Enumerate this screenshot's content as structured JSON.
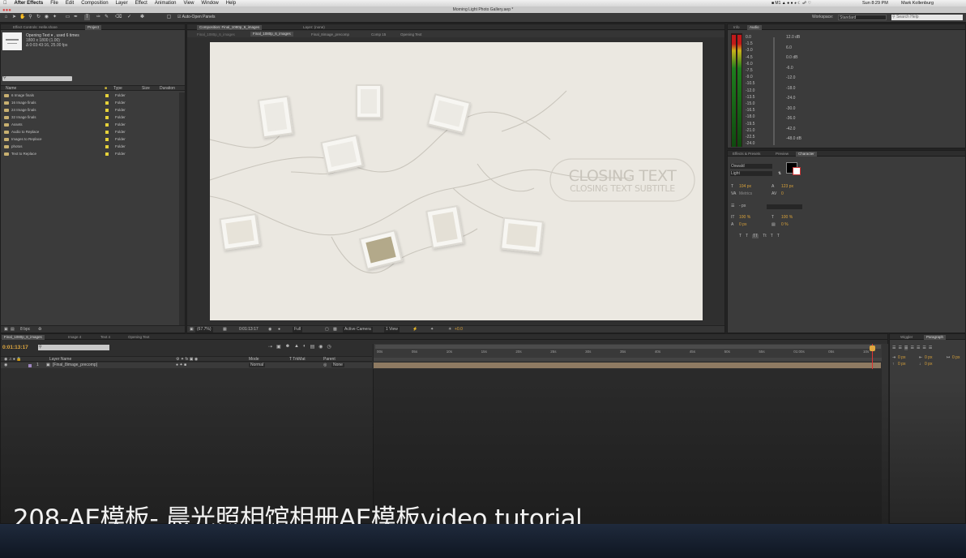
{
  "menubar": {
    "app": "After Effects",
    "items": [
      "File",
      "Edit",
      "Composition",
      "Layer",
      "Effect",
      "Animation",
      "View",
      "Window",
      "Help"
    ],
    "status_time": "Sun 8:29 PM",
    "user": "Mark Kollenburg"
  },
  "window_title": "Morning Light Photo Gallery.aep *",
  "toolbar": {
    "auto_open": "Auto-Open Panels",
    "workspace_label": "Workspace:",
    "workspace_value": "Standard",
    "search_placeholder": "Search Help"
  },
  "project_panel": {
    "tabs": [
      "Effect Controls: Helle.share",
      "Project"
    ],
    "selected_name": "Opening Text ▾ , used 6 times",
    "selected_dims": "1800 x 1800 (1.00)",
    "selected_duration": "Δ 0:03:43:16, 25.00 fps",
    "columns": [
      "Name",
      "Type",
      "Size",
      "Duration"
    ],
    "items": [
      {
        "name": "6 Image finals",
        "type": "Folder"
      },
      {
        "name": "16 Image finals",
        "type": "Folder"
      },
      {
        "name": "24 Image finals",
        "type": "Folder"
      },
      {
        "name": "32 Image finals",
        "type": "Folder"
      },
      {
        "name": "Assets",
        "type": "Folder"
      },
      {
        "name": "Audio to Replace",
        "type": "Folder"
      },
      {
        "name": "Images to Replace",
        "type": "Folder"
      },
      {
        "name": "photos",
        "type": "Folder"
      },
      {
        "name": "Text to Replace",
        "type": "Folder"
      }
    ],
    "bpc": "8 bpc"
  },
  "composition": {
    "panel_tabs": [
      "Composition: Final_1080p_6_images",
      "Layer: (none)"
    ],
    "breadcrumbs": [
      "Final_1080p_6_images",
      "Final_1080p_6_images",
      "Final_8image_precomp",
      "Comp 15",
      "Opening Text"
    ],
    "closing_text": "CLOSING TEXT",
    "closing_subtitle": "CLOSING TEXT SUBTITLE",
    "zoom": "(67.7%)",
    "timecode": "0:01:13:17",
    "resolution": "Full",
    "camera": "Active Camera",
    "views": "1 View",
    "exposure": "+0.0"
  },
  "info_panel": {
    "tabs": [
      "Info",
      "Audio"
    ],
    "left_scale": [
      "0.0",
      "-1.5",
      "-3.0",
      "-4.5",
      "-6.0",
      "-7.5",
      "-9.0",
      "-10.5",
      "-12.0",
      "-13.5",
      "-15.0",
      "-16.5",
      "-18.0",
      "-19.5",
      "-21.0",
      "-22.5",
      "-24.0"
    ],
    "right_scale": [
      "12.0 dB",
      "6.0",
      "0.0 dB",
      "-6.0",
      "-12.0",
      "-18.0",
      "-24.0",
      "-30.0",
      "-36.0",
      "-42.0",
      "-48.0 dB"
    ]
  },
  "character_panel": {
    "tabs": [
      "Effects & Presets",
      "Preview",
      "Character"
    ],
    "font": "Oswald",
    "style": "Light",
    "size": "104 px",
    "leading": "123 px",
    "kerning": "Metrics",
    "tracking": "0",
    "stroke": "- px",
    "vscale": "100 %",
    "hscale": "100 %",
    "baseline": "0 px",
    "tsume": "0 %",
    "format_buttons": [
      "T",
      "T",
      "TT",
      "Tt",
      "T",
      "T"
    ]
  },
  "timeline": {
    "tabs": [
      "Final_1080p_6_images",
      "Image 4",
      "Text 4",
      "Opening Text"
    ],
    "timecode": "0:01:13:17",
    "columns": [
      "Layer Name",
      "Mode",
      "T TrkMat",
      "Parent"
    ],
    "layer": {
      "number": "1",
      "name": "[Final_8image_precomp]",
      "mode": "Normal",
      "parent": "None"
    },
    "ruler": [
      "00s",
      "05s",
      "10s",
      "15s",
      "20s",
      "25s",
      "30s",
      "35s",
      "40s",
      "45s",
      "50s",
      "55s",
      "01:00s",
      "05s",
      "10s"
    ]
  },
  "paragraph_panel": {
    "tabs": [
      "Wiggler",
      "Paragraph"
    ],
    "values": [
      "0 px",
      "0 px",
      "0 px",
      "0 px",
      "0 px"
    ]
  },
  "subtitle": "208-AE模板- 晨光照相馆相册AE模板video tutorial"
}
